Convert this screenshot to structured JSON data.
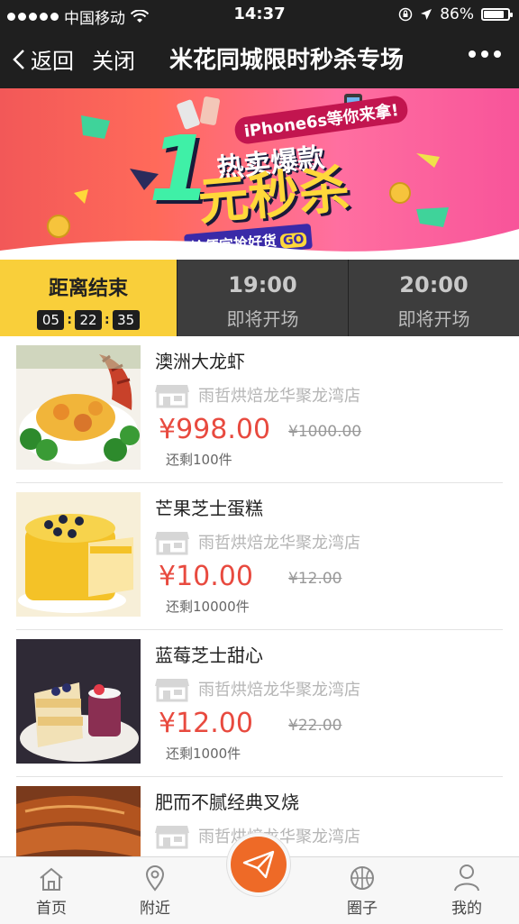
{
  "status_bar": {
    "carrier": "中国移动",
    "time": "14:37",
    "battery_percent": "86%",
    "battery_level": 0.86,
    "icons": [
      "signal-dots-icon",
      "wifi-icon",
      "rotation-lock-icon",
      "location-arrow-icon",
      "battery-icon"
    ]
  },
  "nav": {
    "back_label": "返回",
    "close_label": "关闭",
    "title": "米花同城限时秒杀专场",
    "more_icon": "more-dots-icon"
  },
  "banner": {
    "line1": "iPhone6s等你来拿!",
    "line2": "热卖爆款",
    "big_number": "1",
    "line3": "元秒杀",
    "line4": "捡便宜抢好货",
    "go": "GO",
    "accent_colors": [
      "#f25858",
      "#ff6fa0",
      "#3ff0a7",
      "#ffd83a",
      "#3a2aa8"
    ]
  },
  "tabs": [
    {
      "title": "距离结束",
      "countdown": [
        "05",
        "22",
        "35"
      ],
      "active": true
    },
    {
      "title": "19:00",
      "subtitle": "即将开场",
      "active": false
    },
    {
      "title": "20:00",
      "subtitle": "即将开场",
      "active": false
    }
  ],
  "products": [
    {
      "name": "澳洲大龙虾",
      "shop": "雨哲烘焙龙华聚龙湾店",
      "price": "¥998.00",
      "original_price": "¥1000.00",
      "stock": "还剩100件",
      "image": "lobster"
    },
    {
      "name": "芒果芝士蛋糕",
      "shop": "雨哲烘焙龙华聚龙湾店",
      "price": "¥10.00",
      "original_price": "¥12.00",
      "stock": "还剩10000件",
      "image": "mango-cake"
    },
    {
      "name": "蓝莓芝士甜心",
      "shop": "雨哲烘焙龙华聚龙湾店",
      "price": "¥12.00",
      "original_price": "¥22.00",
      "stock": "还剩1000件",
      "image": "blueberry-dessert"
    },
    {
      "name": "肥而不腻经典叉烧",
      "shop": "雨哲烘焙龙华聚龙湾店",
      "price": "",
      "original_price": "",
      "stock": "",
      "image": "char-siu"
    }
  ],
  "bottom_nav": [
    {
      "label": "首页",
      "icon": "home-icon"
    },
    {
      "label": "附近",
      "icon": "location-pin-icon"
    },
    {
      "label": "",
      "icon": "paper-plane-icon"
    },
    {
      "label": "圈子",
      "icon": "basketball-icon"
    },
    {
      "label": "我的",
      "icon": "user-icon"
    }
  ],
  "colors": {
    "price_red": "#e84a3f",
    "tab_active": "#f9cf3a",
    "tab_inactive": "#3d3d3d",
    "fab_orange": "#ee6a27"
  }
}
